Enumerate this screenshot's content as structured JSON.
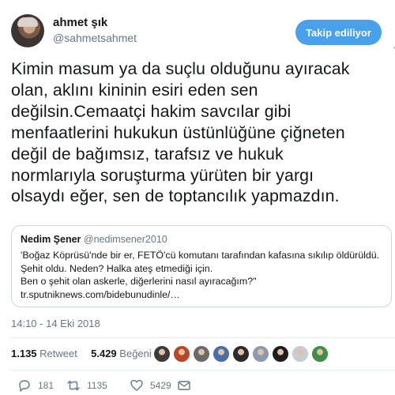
{
  "user": {
    "name": "ahmet şık",
    "handle": "@sahmetsahmet"
  },
  "follow_button": "Takip ediliyor",
  "tweet_lines": [
    "Kimin masum ya da suçlu olduğunu ayıracak",
    "olan, aklını kininin esiri eden sen",
    "değilsin.Cemaatçi hakim savcılar gibi",
    "menfaatlerini hukukun üstünlüğüne çiğneten",
    "değil de bağımsız, tarafsız ve hukuk",
    "normlarıyla soruşturma yürüten bir yargı",
    "olsaydı eğer, sen de toptancılık yapmazdın."
  ],
  "quote": {
    "name": "Nedim Şener",
    "handle": "@nedimsener2010",
    "lines": [
      "'Boğaz Köprüsü'nde bir er, FETÖ'cü komutanı tarafından kafasına sıkılıp öldürüldü.",
      "Şehit oldu. Neden? Halka ateş etmediği için.",
      "Ben o şehit olan askerle, diğerlerini nasıl ayıracağım?\"",
      "tr.sputniknews.com/bidebunudinle/…"
    ]
  },
  "timestamp": "14:10 - 14 Eki 2018",
  "stats": {
    "retweets": "1.135",
    "retweets_label": "Retweet",
    "likes": "5.429",
    "likes_label": "Beğeni"
  },
  "liker_colors": [
    "#3b3b3b",
    "#b8452c",
    "#6a6a6a",
    "#4a6ea8",
    "#2c2c2c",
    "#8a9bb0",
    "#1e1e1e",
    "#c7ccd4",
    "#3f8f4a"
  ],
  "actions": {
    "replies": "181",
    "retweets": "1135",
    "likes": "5429"
  },
  "colors": {
    "accent": "#4aa1eb",
    "muted": "#657786",
    "text": "#14171a"
  }
}
